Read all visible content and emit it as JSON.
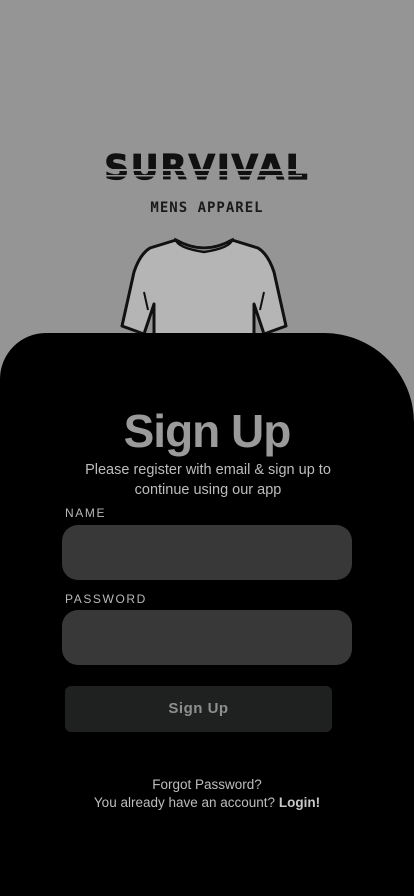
{
  "brand": {
    "logo_text": "SURVIVAL",
    "tagline": "MENS APPAREL"
  },
  "signup": {
    "title": "Sign Up",
    "subtitle": "Please register with email & sign up to continue using our app",
    "name_label": "NAME",
    "name_value": "",
    "password_label": "PASSWORD",
    "password_value": "",
    "submit_label": "Sign Up"
  },
  "footer": {
    "forgot_password": "Forgot Password?",
    "have_account": "You already have  an account?",
    "login_link": "Login!"
  }
}
